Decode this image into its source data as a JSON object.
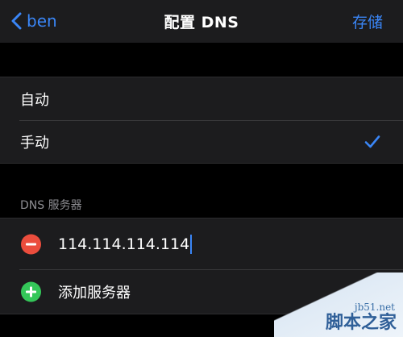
{
  "nav": {
    "back_label": "ben",
    "title": "配置 DNS",
    "save_label": "存储"
  },
  "mode": {
    "options": [
      {
        "label": "自动",
        "selected": false
      },
      {
        "label": "手动",
        "selected": true
      }
    ]
  },
  "dns_section": {
    "header": "DNS 服务器",
    "server_value": "114.114.114.114",
    "add_label": "添加服务器"
  },
  "watermark": {
    "site": "jb51.net",
    "name": "脚本之家"
  },
  "colors": {
    "accent": "#3a86f7",
    "delete": "#eb4d3d",
    "add": "#34c759"
  }
}
